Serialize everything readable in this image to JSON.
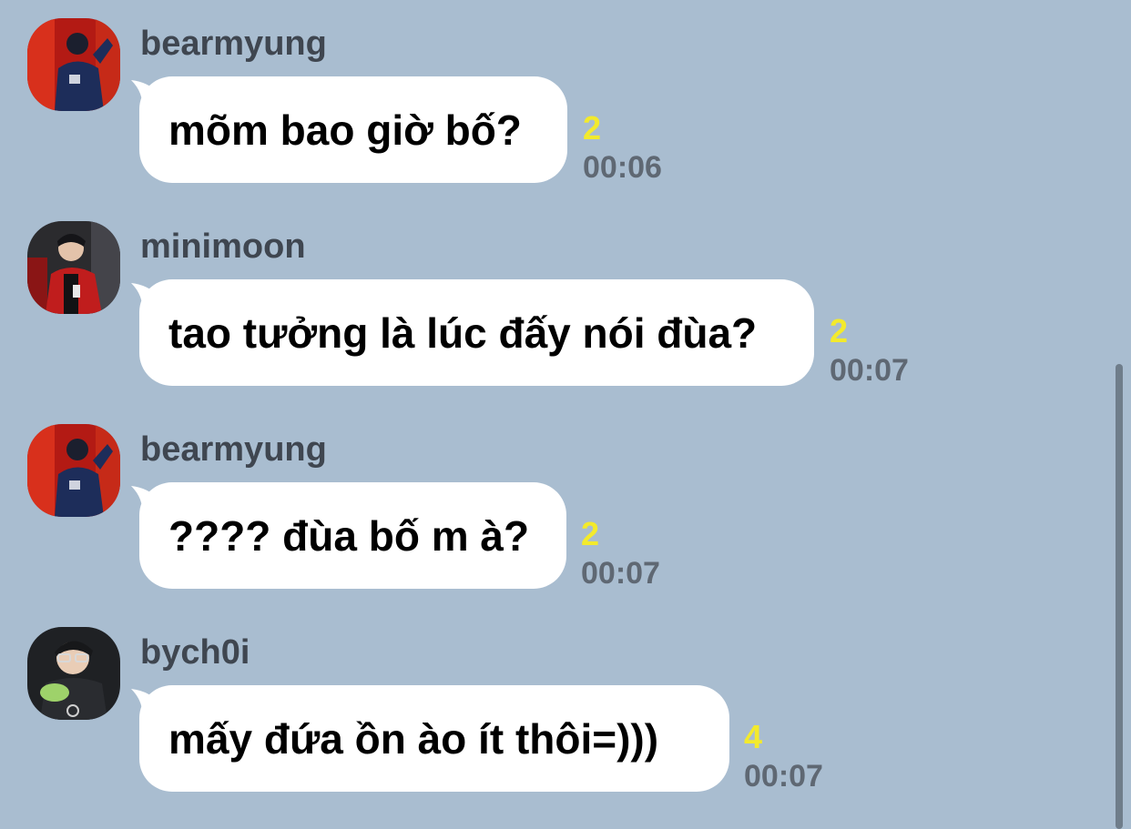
{
  "messages": [
    {
      "sender": "bearmyung",
      "text": "mõm bao giờ bố?",
      "unread": "2",
      "time": "00:06"
    },
    {
      "sender": "minimoon",
      "text": "tao tưởng là lúc đấy nói đùa?",
      "unread": "2",
      "time": "00:07"
    },
    {
      "sender": "bearmyung",
      "text": "???? đùa bố m à?",
      "unread": "2",
      "time": "00:07"
    },
    {
      "sender": "bych0i",
      "text": "mấy đứa ồn ào ít thôi=)))",
      "unread": "4",
      "time": "00:07"
    }
  ],
  "colors": {
    "background": "#a9bdd0",
    "bubble": "#ffffff",
    "unread": "#f3ea2c",
    "time": "#5f6873"
  }
}
